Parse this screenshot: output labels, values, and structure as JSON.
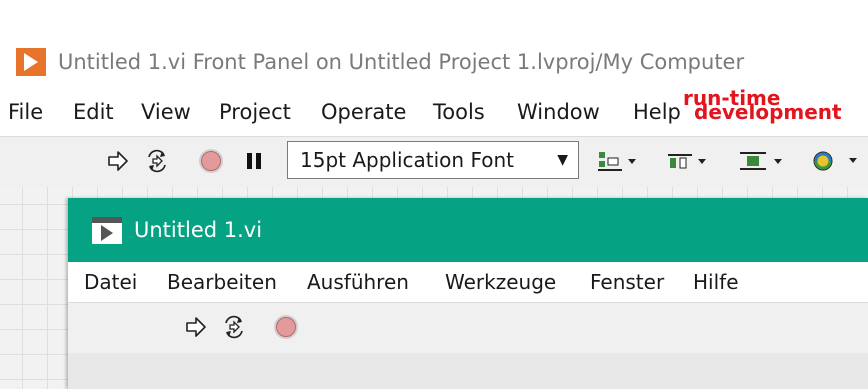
{
  "window": {
    "title": "Untitled 1.vi Front Panel on Untitled Project 1.lvproj/My Computer",
    "logo_icon": "labview-logo-icon"
  },
  "menubar": {
    "items": [
      "File",
      "Edit",
      "View",
      "Project",
      "Operate",
      "Tools",
      "Window",
      "Help"
    ]
  },
  "annotations": {
    "development": "development",
    "runtime": "run-time",
    "color": "#e2141e"
  },
  "toolbar": {
    "font_select_value": "15pt Application Font",
    "icons": [
      "run-arrow-icon",
      "run-continuously-icon",
      "abort-icon",
      "pause-icon",
      "align-objects-icon",
      "distribute-objects-icon",
      "resize-objects-icon",
      "reorder-icon"
    ]
  },
  "runtime_window": {
    "title": "Untitled 1.vi",
    "titlebar_color": "#05a384",
    "menubar": {
      "items": [
        "Datei",
        "Bearbeiten",
        "Ausführen",
        "Werkzeuge",
        "Fenster",
        "Hilfe"
      ]
    },
    "toolbar_icons": [
      "run-arrow-icon",
      "run-continuously-icon",
      "abort-icon"
    ]
  }
}
